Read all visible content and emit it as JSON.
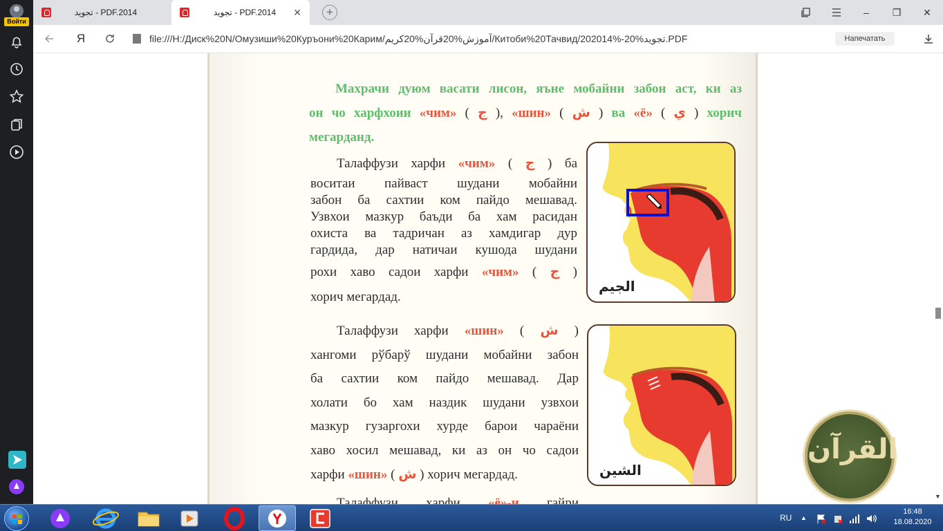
{
  "sidebar": {
    "login_label": "Войти",
    "icons": [
      "bell-icon",
      "history-icon",
      "star-icon",
      "collections-icon",
      "video-icon",
      "telegram-icon",
      "alice-icon"
    ]
  },
  "tabs": [
    {
      "title": "تجوید - PDF.2014",
      "active": false
    },
    {
      "title": "تجوید - PDF.2014",
      "active": true,
      "close": "✕"
    }
  ],
  "window": {
    "new_tab": "+",
    "minimize": "–",
    "restore": "❐",
    "close": "✕"
  },
  "address": {
    "yandex_logo": "Я",
    "url": "file:///H:/Диск%20N/Омузиши%20Куръони%20Карим/آموزش%20قرآن%20کریم/Китоби%20Тачвид/202014%-20%تجوید.PDF",
    "print_label": "Напечатать"
  },
  "document": {
    "heading": {
      "part1": "Махрачи дуюм васати лисон, яъне мобайни забон аст, ки аз",
      "part2": "он чо харфхоии",
      "chim": "«чим»",
      "ar_jim": "ج",
      "shin": "«шин»",
      "ar_shin": "ش",
      "va": "ва",
      "yo": "«ё»",
      "ar_ya": "ي",
      "horij": "хорич",
      "end": "мегарданд."
    },
    "para1": {
      "start": "Талаффузи харфи",
      "chim": "«чим»",
      "ar": "ج",
      "ba": "ба",
      "l2": "воситаи пайваст шудани мобайни",
      "l3": "забон ба сахтии ком пайдо мешавад.",
      "l4": "Узвхои мазкур баъди ба хам расидан",
      "l5": "охиста ва тадричан аз хамдигар дур",
      "l6": "гардида, дар натичаи кушода шудани",
      "l7": "рохи хаво садои харфи",
      "chim2": "«чим»",
      "ar2": "ج",
      "l8": "хорич мегардад."
    },
    "para2": {
      "start": "Талаффузи харфи",
      "shin": "«шин»",
      "ar": "ش",
      "l2": "хангоми рўбарў шудани мобайни забон",
      "l3": "ба сахтии ком пайдо мешавад. Дар",
      "l4": "холати бо хам наздик шудани узвхои",
      "l5": "мазкур гузаргохи хурде барои чараёни",
      "l6": "хаво хосил мешавад, ки аз он чо садои",
      "l7a": "харфи",
      "shin2": "«шин»",
      "ar2": "ش",
      "l7b": "хорич мегардад."
    },
    "para3": {
      "start": "Талаффузи харфи",
      "yo": "«ё»-и",
      "end": "гайри"
    },
    "figure1_caption": "الجيم",
    "figure2_caption": "الشين"
  },
  "overlay": {
    "logo_glyph": "القرآن"
  },
  "taskbar": {
    "apps": [
      "alice",
      "internet-explorer",
      "explorer",
      "media-player",
      "opera",
      "yandex-browser",
      "pdf-app"
    ],
    "lang": "RU",
    "time": "16:48",
    "date": "18.08.2020"
  }
}
